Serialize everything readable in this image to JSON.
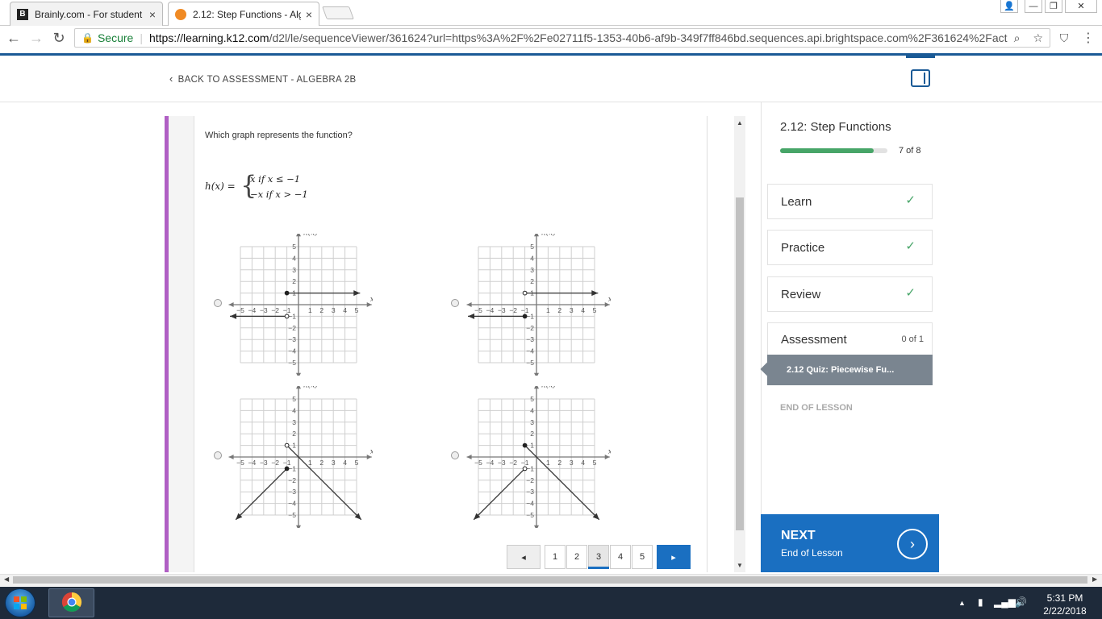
{
  "browser": {
    "tabs": [
      {
        "title": "Brainly.com - For student",
        "close": "×"
      },
      {
        "title": "2.12: Step Functions - Alg",
        "close": "×"
      }
    ],
    "window_controls": {
      "user": "👤",
      "minimize": "—",
      "restore": "❐",
      "close": "✕"
    },
    "address": {
      "secure_label": "Secure",
      "url_host": "https://learning.k12.com",
      "url_path": "/d2l/le/sequenceViewer/361624?url=https%3A%2F%2Fe02711f5-1353-40b6-af9b-349f7ff846bd.sequences.api.brightspace.com%2F361624%2Fact..."
    }
  },
  "header": {
    "back_link": "BACK TO ASSESSMENT - ALGEBRA 2B"
  },
  "question": {
    "prompt": "Which graph represents the function?",
    "function_lhs": "h(x) =",
    "case1": "x if x ≤ −1",
    "case2": "−x if x > −1"
  },
  "graph_labels": {
    "y_axis": "h(x)",
    "x_axis": "x",
    "x_ticks": [
      "−5",
      "−4",
      "−3",
      "−2",
      "−1",
      "1",
      "2",
      "3",
      "4",
      "5"
    ],
    "y_ticks": [
      "5",
      "4",
      "3",
      "2",
      "1",
      "−1",
      "−2",
      "−3",
      "−4",
      "−5"
    ]
  },
  "pagination": {
    "prev": "◂",
    "pages": [
      "1",
      "2",
      "3",
      "4",
      "5"
    ],
    "current": "3",
    "next": "▸"
  },
  "sidebar": {
    "title": "2.12: Step Functions",
    "progress": {
      "text": "7 of 8",
      "fraction": 0.875
    },
    "items": [
      {
        "label": "Learn",
        "status": "✓"
      },
      {
        "label": "Practice",
        "status": "✓"
      },
      {
        "label": "Review",
        "status": "✓"
      },
      {
        "label": "Assessment",
        "count": "0 of 1"
      }
    ],
    "quiz_item": "2.12 Quiz: Piecewise Fu...",
    "end_of_lesson": "END OF LESSON",
    "next": {
      "label": "NEXT",
      "sub": "End of Lesson",
      "icon": "›"
    }
  },
  "taskbar": {
    "time": "5:31 PM",
    "date": "2/22/2018"
  },
  "colors": {
    "accent_blue": "#1a6fc1",
    "purple_bar": "#b05fc4",
    "progress_green": "#47a568",
    "taskbar": "#1e2a3a"
  }
}
